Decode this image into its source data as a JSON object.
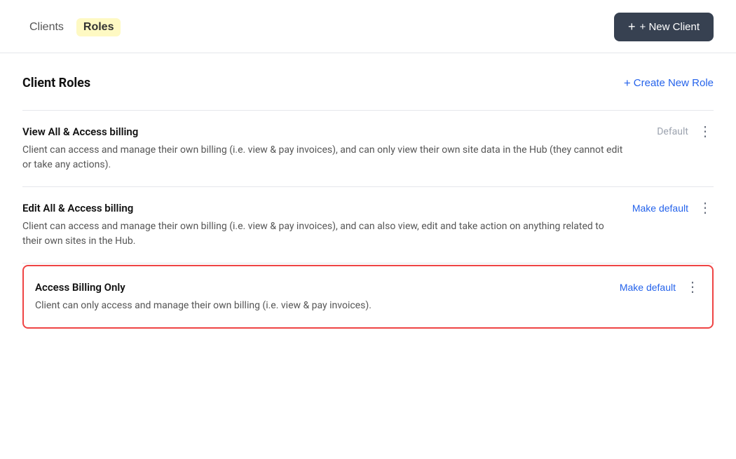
{
  "nav": {
    "tabs": [
      {
        "id": "clients",
        "label": "Clients",
        "active": false
      },
      {
        "id": "roles",
        "label": "Roles",
        "active": true
      }
    ],
    "new_client_button": "+ New Client",
    "new_client_plus": "+"
  },
  "section": {
    "title": "Client Roles",
    "create_role_label": "Create New Role",
    "create_role_plus": "+"
  },
  "roles": [
    {
      "id": "role-1",
      "name": "View All & Access billing",
      "status": "Default",
      "status_type": "default",
      "description": "Client can access and manage their own billing (i.e. view & pay invoices), and can only view their own site data in the Hub (they cannot edit or take any actions).",
      "highlighted": false
    },
    {
      "id": "role-2",
      "name": "Edit All & Access billing",
      "status": "Make default",
      "status_type": "make-default",
      "description": "Client can access and manage their own billing (i.e. view & pay invoices), and can also view, edit and take action on anything related to their own sites in the Hub.",
      "highlighted": false
    },
    {
      "id": "role-3",
      "name": "Access Billing Only",
      "status": "Make default",
      "status_type": "make-default",
      "description": "Client can only access and manage their own billing (i.e. view & pay invoices).",
      "highlighted": true
    }
  ]
}
